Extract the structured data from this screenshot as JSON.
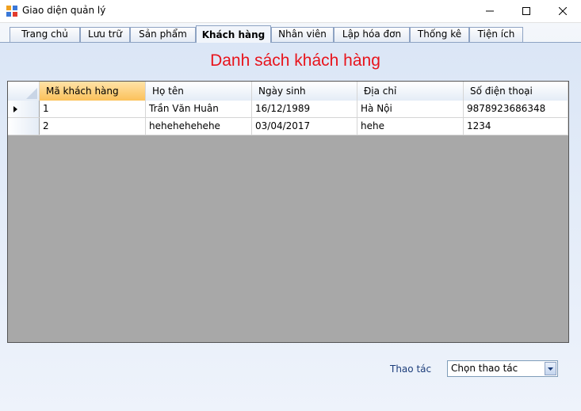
{
  "window": {
    "title": "Giao diện quản lý"
  },
  "tabs": [
    {
      "label": "Trang chủ"
    },
    {
      "label": "Lưu trữ"
    },
    {
      "label": "Sản phẩm"
    },
    {
      "label": "Khách hàng"
    },
    {
      "label": "Nhân viên"
    },
    {
      "label": "Lập hóa đơn"
    },
    {
      "label": "Thống kê"
    },
    {
      "label": "Tiện ích"
    }
  ],
  "active_tab": "Khách hàng",
  "main": {
    "heading": "Danh sách khách hàng"
  },
  "table": {
    "columns": [
      "Mã khách hàng",
      "Họ tên",
      "Ngày sinh",
      "Địa chỉ",
      "Số điện thoại"
    ],
    "rows": [
      [
        "1",
        "Trần Văn Huân",
        "16/12/1989",
        "Hà Nội",
        "9878923686348"
      ],
      [
        "2",
        "hehehehehehe",
        "03/04/2017",
        "hehe",
        "1234"
      ]
    ]
  },
  "actions": {
    "label": "Thao tác",
    "select_value": "Chọn thao tác"
  },
  "colors": {
    "heading": "#e8141c",
    "grid_background": "#a8a8a8",
    "selected_header": "#fbc15a"
  },
  "icons": {
    "app": "app-icon",
    "minimize": "minimize-icon",
    "maximize": "maximize-icon",
    "close": "close-icon",
    "row_pointer": "row-pointer-icon",
    "dropdown": "chevron-down-icon"
  }
}
